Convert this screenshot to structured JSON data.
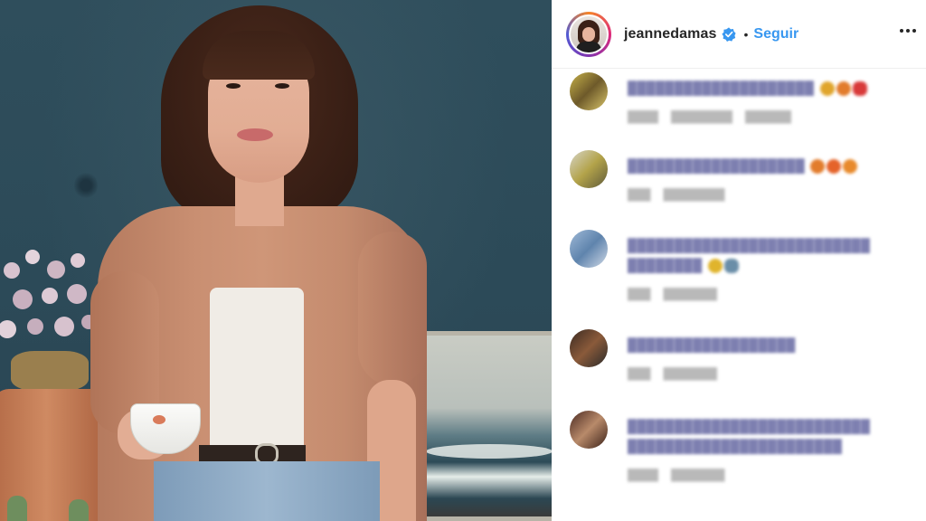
{
  "post": {
    "username": "jeannedamas",
    "separator": "•",
    "follow_label": "Seguir"
  },
  "icons": {
    "verified": "verified-badge-icon",
    "more": "more-options-icon"
  },
  "colors": {
    "follow_blue": "#3897f0",
    "verified_blue": "#3897f0",
    "text_dark": "#262626"
  },
  "comments": [
    {
      "text": "",
      "meta": [
        "",
        "",
        ""
      ]
    },
    {
      "text": "",
      "meta": [
        "",
        ""
      ]
    },
    {
      "text": "",
      "meta": [
        "",
        ""
      ]
    },
    {
      "text": "",
      "meta": [
        "",
        ""
      ]
    },
    {
      "text": "",
      "meta": [
        "",
        ""
      ]
    }
  ]
}
